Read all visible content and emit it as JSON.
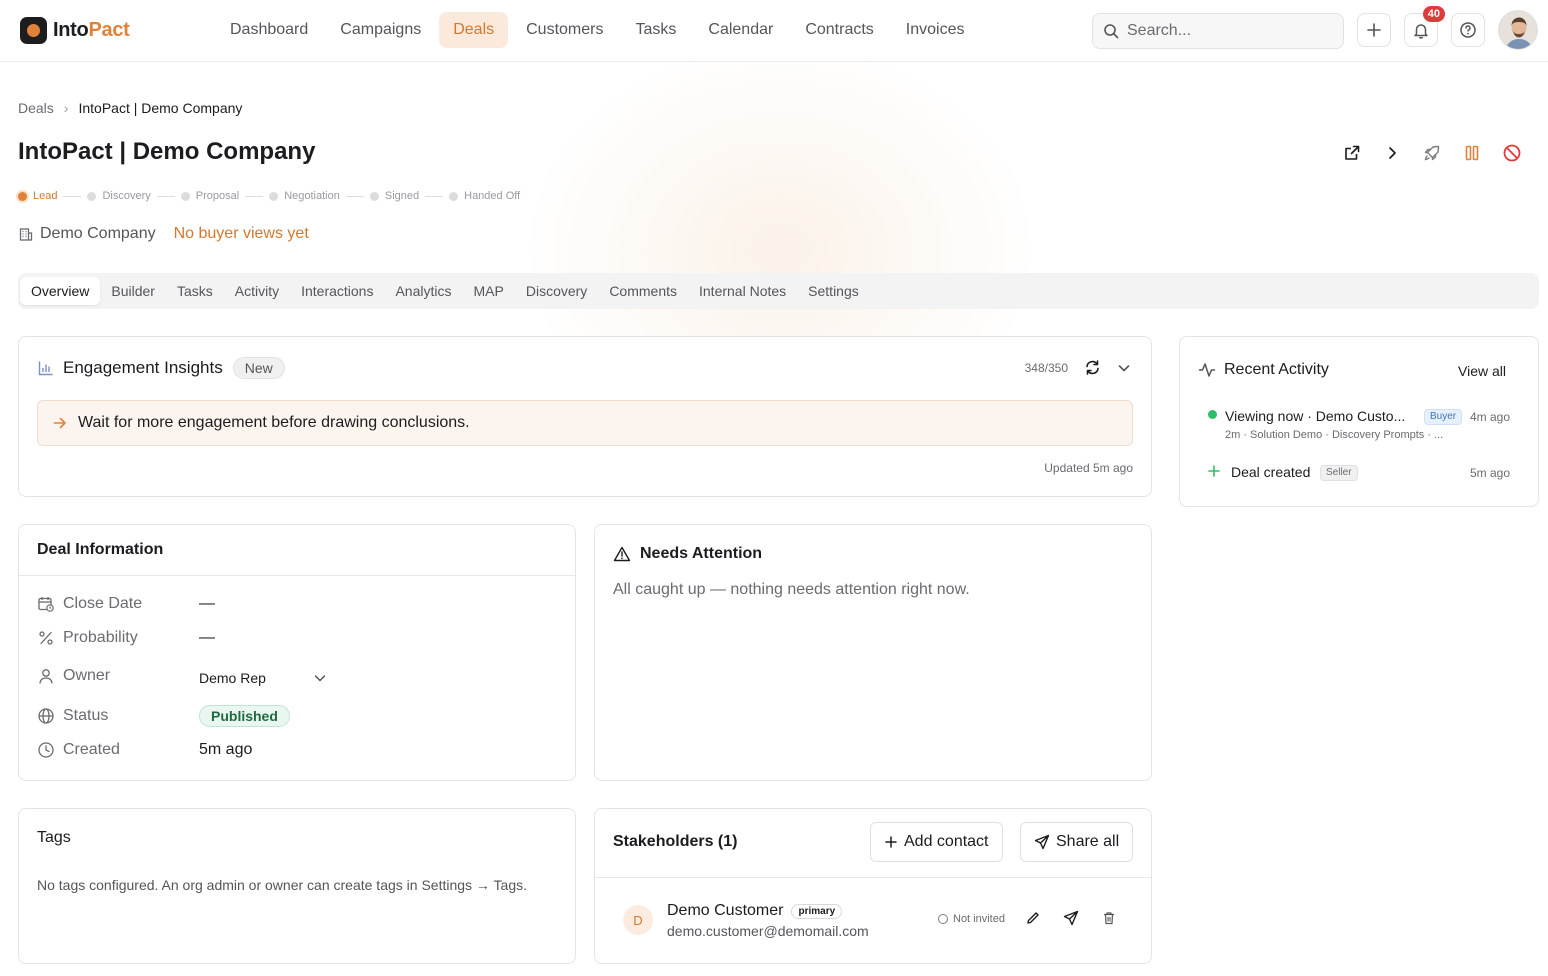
{
  "app": {
    "logo_text_a": "Into",
    "logo_text_b": "Pact",
    "brand_color": "#e0823a"
  },
  "nav": {
    "items": [
      {
        "label": "Dashboard"
      },
      {
        "label": "Campaigns"
      },
      {
        "label": "Deals",
        "active": true
      },
      {
        "label": "Customers"
      },
      {
        "label": "Tasks"
      },
      {
        "label": "Calendar"
      },
      {
        "label": "Contracts"
      },
      {
        "label": "Invoices"
      }
    ]
  },
  "search": {
    "placeholder": "Search..."
  },
  "notifications": {
    "count": "40"
  },
  "breadcrumb": {
    "root": "Deals",
    "current": "IntoPact | Demo Company"
  },
  "page": {
    "title": "IntoPact | Demo Company"
  },
  "stages": [
    {
      "label": "Lead",
      "current": true
    },
    {
      "label": "Discovery"
    },
    {
      "label": "Proposal"
    },
    {
      "label": "Negotiation"
    },
    {
      "label": "Signed"
    },
    {
      "label": "Handed Off"
    }
  ],
  "company": {
    "name": "Demo Company",
    "views": "No buyer views yet"
  },
  "tabs": [
    {
      "label": "Overview",
      "active": true
    },
    {
      "label": "Builder"
    },
    {
      "label": "Tasks"
    },
    {
      "label": "Activity"
    },
    {
      "label": "Interactions"
    },
    {
      "label": "Analytics"
    },
    {
      "label": "MAP"
    },
    {
      "label": "Discovery"
    },
    {
      "label": "Comments"
    },
    {
      "label": "Internal Notes"
    },
    {
      "label": "Settings"
    }
  ],
  "insights": {
    "title": "Engagement Insights",
    "badge": "New",
    "counter": "348/350",
    "message": "Wait for more engagement before drawing conclusions.",
    "updated": "Updated 5m ago"
  },
  "recent_activity": {
    "title": "Recent Activity",
    "view_all": "View all",
    "items": [
      {
        "title": "Viewing now · Demo Custo...",
        "badge": "Buyer",
        "time": "4m ago",
        "sub": "2m · Solution Demo · Discovery Prompts · ..."
      },
      {
        "title": "Deal created",
        "badge": "Seller",
        "time": "5m ago"
      }
    ]
  },
  "deal_info": {
    "title": "Deal Information",
    "rows": [
      {
        "label": "Close Date",
        "value": "—"
      },
      {
        "label": "Probability",
        "value": "—"
      },
      {
        "label": "Owner",
        "value": "Demo Rep"
      },
      {
        "label": "Status",
        "value": "Published"
      },
      {
        "label": "Created",
        "value": "5m ago"
      }
    ]
  },
  "attention": {
    "title": "Needs Attention",
    "message": "All caught up — nothing needs attention right now."
  },
  "tags": {
    "title": "Tags",
    "message": "No tags configured. An org admin or owner can create tags in Settings → Tags."
  },
  "stakeholders": {
    "title": "Stakeholders (1)",
    "add_label": "Add contact",
    "share_label": "Share all",
    "contacts": [
      {
        "initial": "D",
        "name": "Demo Customer",
        "tag": "primary",
        "email": "demo.customer@demomail.com",
        "status": "Not invited"
      }
    ]
  }
}
